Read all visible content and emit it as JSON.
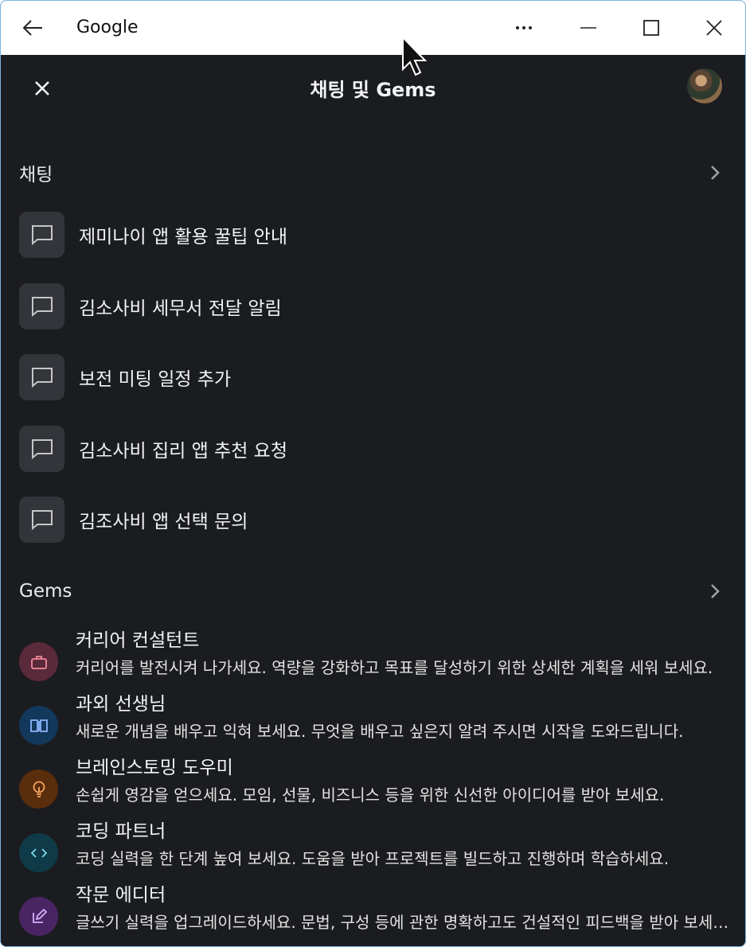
{
  "window": {
    "title": "Google"
  },
  "app": {
    "title": "채팅 및 Gems"
  },
  "chats": {
    "heading": "채팅",
    "items": [
      {
        "label": "제미나이 앱 활용 꿀팁 안내"
      },
      {
        "label": "김소사비 세무서 전달 알림"
      },
      {
        "label": "보전 미팅 일정 추가"
      },
      {
        "label": "김소사비 집리 앱 추천 요청"
      },
      {
        "label": "김조사비 앱 선택 문의"
      }
    ]
  },
  "gems": {
    "heading": "Gems",
    "items": [
      {
        "title": "커리어 컨설턴트",
        "desc": "커리어를 발전시켜 나가세요. 역량을 강화하고 목표를 달성하기 위한 상세한 계획을 세워 보세요.",
        "icon": "briefcase-icon",
        "color": "#5a2a3a",
        "fg": "#f28b9b"
      },
      {
        "title": "과외 선생님",
        "desc": "새로운 개념을 배우고 익혀 보세요. 무엇을 배우고 싶은지 알려 주시면 시작을 도와드립니다.",
        "icon": "book-icon",
        "color": "#12385c",
        "fg": "#8ab4f8"
      },
      {
        "title": "브레인스토밍 도우미",
        "desc": "손쉽게 영감을 얻으세요. 모임, 선물, 비즈니스 등을 위한 신선한 아이디어를 받아 보세요.",
        "icon": "lightbulb-icon",
        "color": "#5a2d0c",
        "fg": "#f6a560"
      },
      {
        "title": "코딩 파트너",
        "desc": "코딩 실력을 한 단계 높여 보세요. 도움을 받아 프로젝트를 빌드하고 진행하며 학습하세요.",
        "icon": "code-icon",
        "color": "#0f3a47",
        "fg": "#78d9ec"
      },
      {
        "title": "작문 에디터",
        "desc": "글쓰기 실력을 업그레이드하세요. 문법, 구성 등에 관한 명확하고도 건설적인 피드백을 받아 보세요.",
        "icon": "pencil-icon",
        "color": "#4a2563",
        "fg": "#d7aefb"
      }
    ]
  }
}
